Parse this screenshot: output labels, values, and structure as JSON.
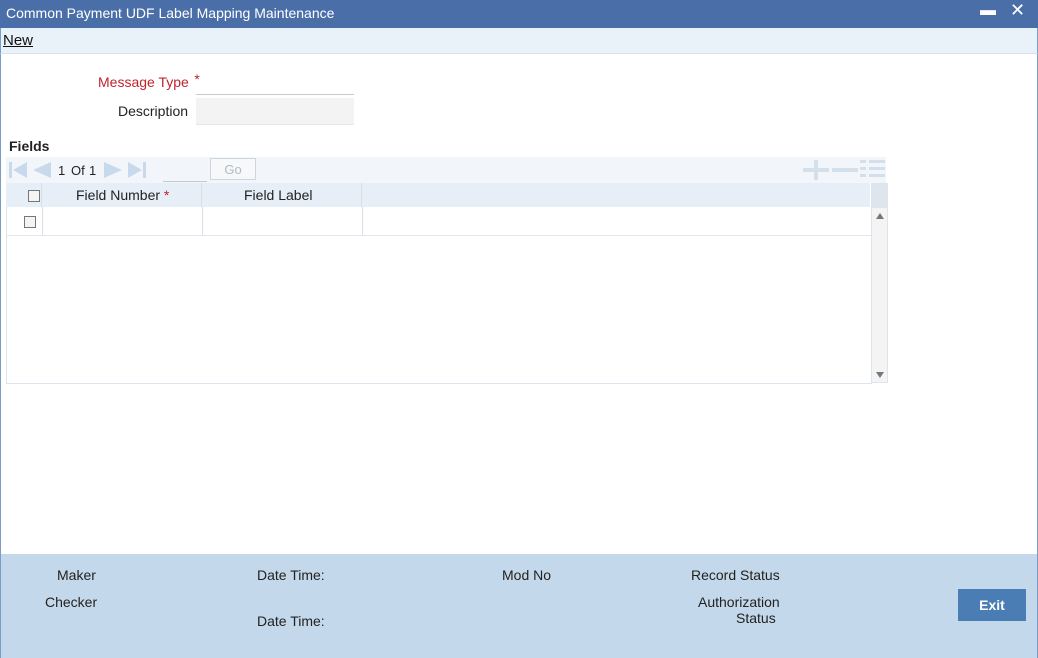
{
  "window": {
    "title": "Common Payment UDF Label Mapping Maintenance",
    "minimize": "▬",
    "close": "✕"
  },
  "toolbar": {
    "new_label": "New"
  },
  "form": {
    "message_type_label": "Message Type",
    "required_mark": "*",
    "message_type_value": "",
    "description_label": "Description",
    "description_value": ""
  },
  "fields_section": {
    "title": "Fields",
    "pagination": {
      "current": "1",
      "of_label": "Of",
      "total": "1",
      "go_label": "Go",
      "page_input": ""
    },
    "columns": [
      "Field Number",
      "Field Label"
    ],
    "rows": [
      {
        "field_number": "",
        "field_label": ""
      }
    ]
  },
  "footer": {
    "maker_label": "Maker",
    "checker_label": "Checker",
    "date_time_label_1": "Date Time:",
    "date_time_label_2": "Date Time:",
    "mod_no_label": "Mod No",
    "record_status_label": "Record Status",
    "authorization_label_line1": "Authorization",
    "authorization_label_line2": "Status",
    "exit_label": "Exit"
  },
  "colors": {
    "titlebar": "#4a6fa8",
    "required": "#c0232c",
    "footer": "#c3d8ea",
    "exit_button": "#4a7db4"
  }
}
